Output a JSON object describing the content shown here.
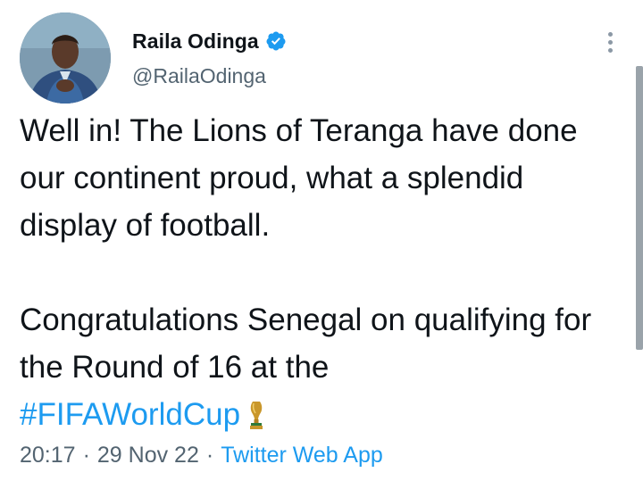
{
  "tweet": {
    "author": {
      "display_name": "Raila Odinga",
      "handle": "@RailaOdinga",
      "verified": true
    },
    "text_lines": {
      "p1": "Well in! The Lions of Teranga have done our continent proud, what a splendid display of football.",
      "p2": "Congratulations Senegal on qualifying for the Round of 16 at the",
      "hashtag": "#FIFAWorldCup"
    },
    "meta": {
      "time": "20:17",
      "date": "29 Nov 22",
      "separator": "·",
      "source": "Twitter Web App"
    }
  },
  "icons": {
    "verified": "verified-badge-icon",
    "more": "more-options-icon",
    "trophy": "trophy-emoji-icon"
  },
  "colors": {
    "link": "#1d9bf0",
    "secondary_text": "#536471",
    "primary_text": "#0f1419",
    "verified_badge": "#1d9bf0"
  }
}
